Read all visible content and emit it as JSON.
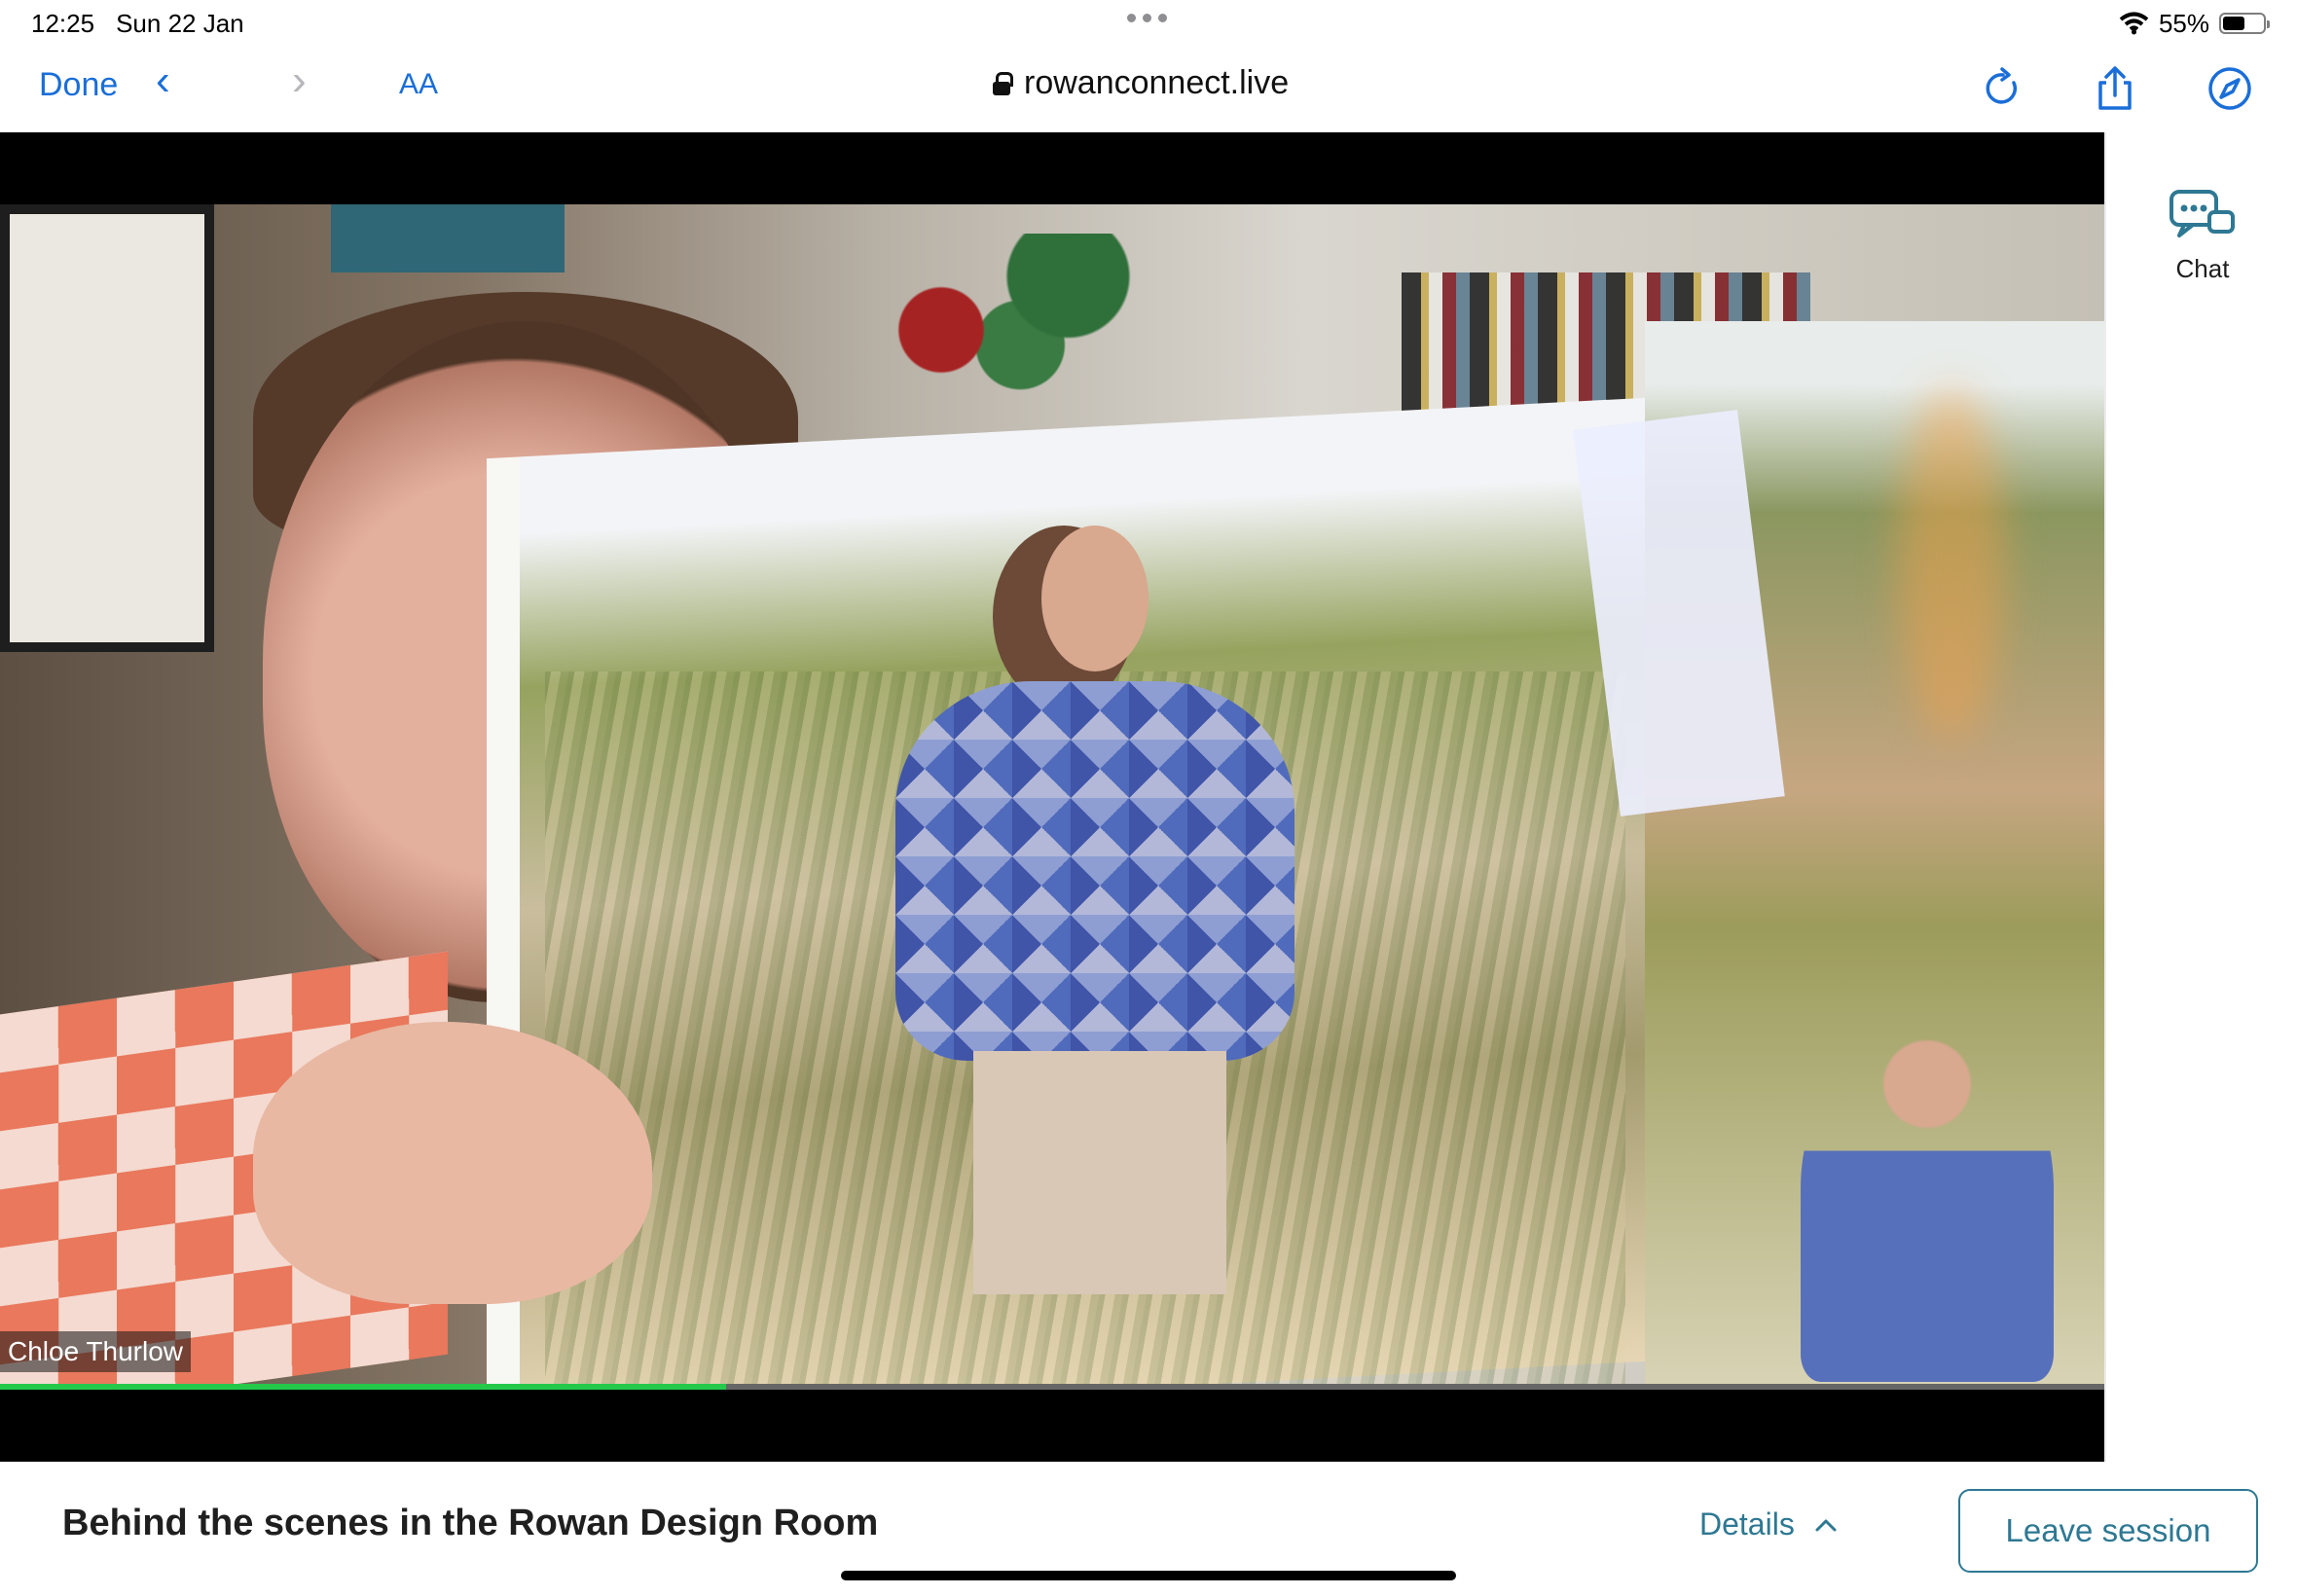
{
  "status_bar": {
    "time": "12:25",
    "date": "Sun 22 Jan",
    "battery": "55%",
    "battery_level": 0.55,
    "icons": [
      "wifi-icon",
      "battery-icon"
    ]
  },
  "browser": {
    "done_label": "Done",
    "text_size_label": "AA",
    "url": "rowanconnect.live",
    "icons": {
      "back": "chevron-left-icon",
      "forward": "chevron-right-icon",
      "secure": "lock-icon",
      "reload": "reload-icon",
      "share": "share-icon",
      "safari": "compass-icon"
    }
  },
  "video": {
    "participant_name": "Chloe Thurlow",
    "progress": 0.345
  },
  "side_panel": {
    "chat_label": "Chat",
    "chat_icon": "chat-icon"
  },
  "session": {
    "title": "Behind the scenes in the Rowan Design Room",
    "details_label": "Details",
    "leave_label": "Leave session"
  },
  "colors": {
    "ios_blue": "#1a6ed8",
    "accent_teal": "#2e7893",
    "progress_green": "#24c84a"
  }
}
